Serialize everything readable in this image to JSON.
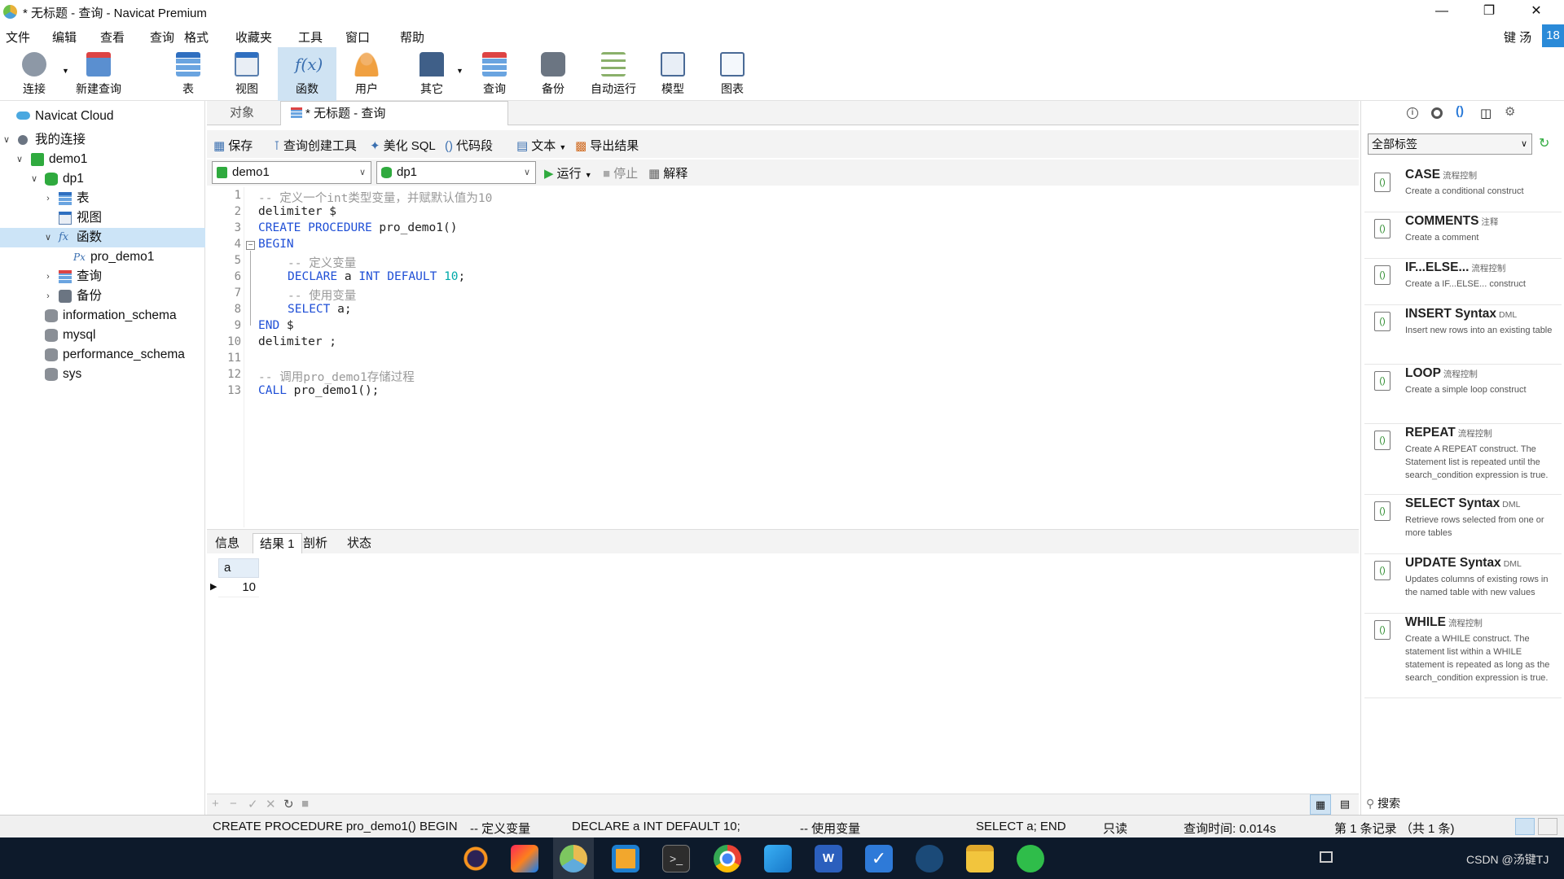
{
  "window": {
    "title": "* 无标题 - 查询 - Navicat Premium"
  },
  "menubar": {
    "items": [
      "文件",
      "编辑",
      "查看",
      "查询",
      "格式",
      "收藏夹",
      "工具",
      "窗口",
      "帮助"
    ],
    "user": "键 汤",
    "badge": "18"
  },
  "toolbar": {
    "items": [
      "连接",
      "新建查询",
      "表",
      "视图",
      "函数",
      "用户",
      "其它",
      "查询",
      "备份",
      "自动运行",
      "模型",
      "图表"
    ]
  },
  "sidebar": {
    "cloud": "Navicat Cloud",
    "my_connections": "我的连接",
    "demo1": "demo1",
    "dp1": "dp1",
    "tables": "表",
    "views": "视图",
    "functions": "函数",
    "pro_demo1": "pro_demo1",
    "queries": "查询",
    "backups": "备份",
    "information_schema": "information_schema",
    "mysql": "mysql",
    "performance_schema": "performance_schema",
    "sys": "sys"
  },
  "tabs": {
    "objects": "对象",
    "query": "* 无标题 - 查询"
  },
  "query_toolbar": {
    "save": "保存",
    "builder": "查询创建工具",
    "beautify": "美化 SQL",
    "snippet": "代码段",
    "text": "文本",
    "export": "导出结果"
  },
  "selectors": {
    "connection": "demo1",
    "database": "dp1",
    "run": "运行",
    "stop": "停止",
    "explain": "解释"
  },
  "editor": {
    "line_numbers": [
      "1",
      "2",
      "3",
      "4",
      "5",
      "6",
      "7",
      "8",
      "9",
      "10",
      "11",
      "12",
      "13"
    ],
    "l1": "-- 定义一个int类型变量，并赋默认值为10",
    "l2": "delimiter $",
    "l3_kw": "CREATE PROCEDURE",
    "l3_rest": " pro_demo1()",
    "l4": "BEGIN",
    "l5": "-- 定义变量",
    "l6_kw1": "DECLARE",
    "l6_mid": " a ",
    "l6_kw2": "INT DEFAULT",
    "l6_num": " 10",
    "l6_end": ";",
    "l7": "-- 使用变量",
    "l8_kw": "SELECT",
    "l8_rest": " a;",
    "l9_kw": "END",
    "l9_rest": " $",
    "l10": "delimiter ;",
    "l12": "-- 调用pro_demo1存储过程",
    "l13_kw": "CALL",
    "l13_rest": " pro_demo1();"
  },
  "result_tabs": [
    "信息",
    "结果 1",
    "剖析",
    "状态"
  ],
  "result": {
    "column": "a",
    "value": "10"
  },
  "right_panel": {
    "filter": "全部标签",
    "search": "搜索",
    "snippets": [
      {
        "title": "CASE",
        "tag": "流程控制",
        "desc": "Create a conditional construct"
      },
      {
        "title": "COMMENTS",
        "tag": "注释",
        "desc": "Create a comment"
      },
      {
        "title": "IF...ELSE...",
        "tag": "流程控制",
        "desc": "Create a IF...ELSE... construct"
      },
      {
        "title": "INSERT Syntax",
        "tag": "DML",
        "desc": "Insert new rows into an existing table"
      },
      {
        "title": "LOOP",
        "tag": "流程控制",
        "desc": "Create a simple loop construct"
      },
      {
        "title": "REPEAT",
        "tag": "流程控制",
        "desc": "Create A REPEAT construct. The Statement list is repeated until the search_condition expression is true."
      },
      {
        "title": "SELECT Syntax",
        "tag": "DML",
        "desc": "Retrieve rows selected from one or more tables"
      },
      {
        "title": "UPDATE Syntax",
        "tag": "DML",
        "desc": "Updates columns of existing rows in the named table with new values"
      },
      {
        "title": "WHILE",
        "tag": "流程控制",
        "desc": "Create a WHILE construct. The statement list within a WHILE statement is repeated as long as the search_condition expression is true."
      }
    ]
  },
  "statusbar": {
    "s1": "CREATE PROCEDURE pro_demo1() BEGIN",
    "s2": "-- 定义变量",
    "s3": "DECLARE a INT DEFAULT 10;",
    "s4": "-- 使用变量",
    "s5": "SELECT a; END",
    "s6": "只读",
    "s7": "查询时间: 0.014s",
    "s8": "第 1 条记录 （共 1 条)"
  },
  "taskbar": {
    "watermark": "CSDN @汤键TJ"
  }
}
